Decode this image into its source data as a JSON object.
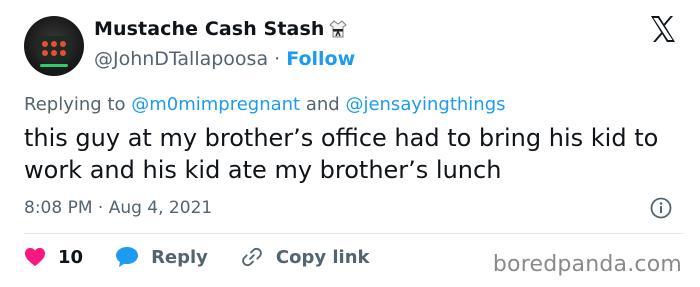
{
  "author": {
    "display_name": "Mustache Cash Stash",
    "handle": "@JohnDTallapoosa",
    "separator": "·",
    "follow_label": "Follow"
  },
  "reply_context": {
    "prefix": "Replying to",
    "mention_1": "@m0mimpregnant",
    "conjunction": "and",
    "mention_2": "@jensayingthings"
  },
  "tweet": {
    "text": "this guy at my brother’s office had to bring his kid to work and his kid ate my brother’s lunch",
    "timestamp": "8:08 PM · Aug 4, 2021"
  },
  "actions": {
    "likes_count": "10",
    "reply_label": "Reply",
    "copy_link_label": "Copy link"
  },
  "watermark": "boredpanda.com",
  "colors": {
    "accent_blue": "#1d9bf0",
    "like_red": "#f91880",
    "secondary_text": "#536471",
    "primary_text": "#0f1419"
  },
  "icons": {
    "badge": "karate-uniform-icon",
    "brand": "x-logo-icon",
    "info": "info-icon",
    "like": "heart-icon",
    "reply": "speech-bubble-icon",
    "copy": "link-icon"
  }
}
